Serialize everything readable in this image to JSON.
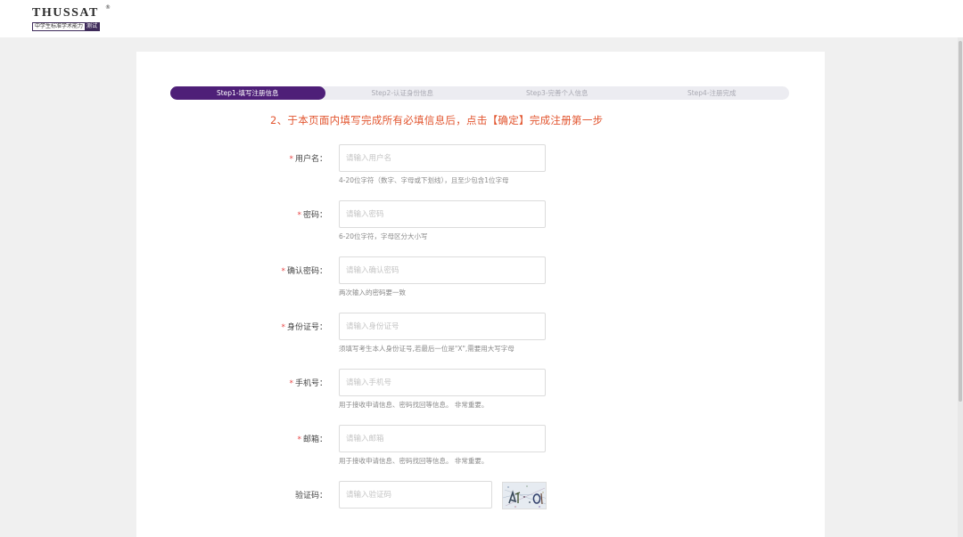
{
  "brand": {
    "name": "THUSSAT",
    "registered": "®",
    "subtitle": "中学生标准学术能力",
    "subtitle_tag": "测试"
  },
  "steps": [
    {
      "label": "Step1-填写注册信息",
      "active": true
    },
    {
      "label": "Step2-认证身份信息",
      "active": false
    },
    {
      "label": "Step3-完善个人信息",
      "active": false
    },
    {
      "label": "Step4-注册完成",
      "active": false
    }
  ],
  "notice": "2、于本页面内填写完成所有必填信息后，点击【确定】完成注册第一步",
  "form": {
    "username": {
      "label": "用户名：",
      "placeholder": "请输入用户名",
      "hint": "4-20位字符（数字、字母或下划线），且至少包含1位字母",
      "required": true
    },
    "password": {
      "label": "密码：",
      "placeholder": "请输入密码",
      "hint": "6-20位字符，字母区分大小写",
      "required": true
    },
    "confirm_password": {
      "label": "确认密码：",
      "placeholder": "请输入确认密码",
      "hint": "两次输入的密码要一致",
      "required": true
    },
    "id_number": {
      "label": "身份证号：",
      "placeholder": "请输入身份证号",
      "hint": "须填写考生本人身份证号,若最后一位是\"X\",需要用大写字母",
      "required": true
    },
    "phone": {
      "label": "手机号：",
      "placeholder": "请输入手机号",
      "hint": "用于接收申请信息、密码找回等信息。 非常重要。",
      "required": true
    },
    "email": {
      "label": "邮箱：",
      "placeholder": "请输入邮箱",
      "hint": "用于接收申请信息、密码找回等信息。 非常重要。",
      "required": true
    },
    "captcha": {
      "label": "验证码：",
      "placeholder": "请输入验证码",
      "required": false
    }
  },
  "required_mark": "*",
  "colors": {
    "accent": "#4e1f78",
    "notice": "#e2552f",
    "required": "#e84a4a"
  }
}
